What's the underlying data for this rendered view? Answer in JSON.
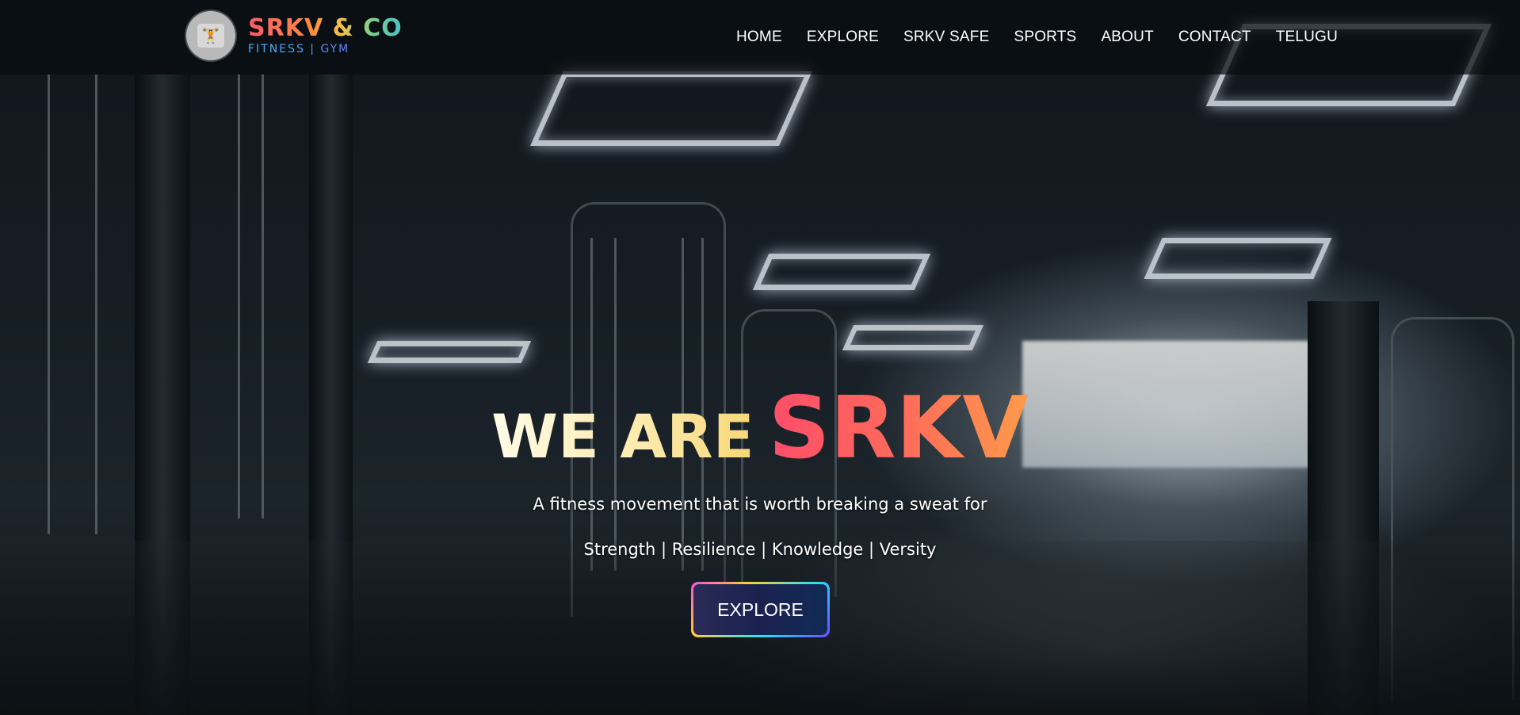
{
  "brand": {
    "logo_icon": "gym-logo-icon",
    "title": "SRKV & CO",
    "subtitle": "FITNESS | GYM"
  },
  "nav": {
    "items": [
      {
        "label": "HOME"
      },
      {
        "label": "EXPLORE"
      },
      {
        "label": "SRKV SAFE"
      },
      {
        "label": "SPORTS"
      },
      {
        "label": "ABOUT"
      },
      {
        "label": "CONTACT"
      },
      {
        "label": "TELUGU"
      }
    ]
  },
  "hero": {
    "headline_prefix": "WE ARE",
    "headline_brand": "SRKV",
    "tagline": "A fitness movement that is worth breaking a sweat for",
    "values_line": "Strength | Resilience | Knowledge | Versity",
    "cta_label": "EXPLORE"
  },
  "colors": {
    "headline_prefix": "#fde9a9",
    "headline_brand": "#ff5a5f",
    "nav_text": "#ffffff",
    "cta_bg": "#1b2250"
  }
}
